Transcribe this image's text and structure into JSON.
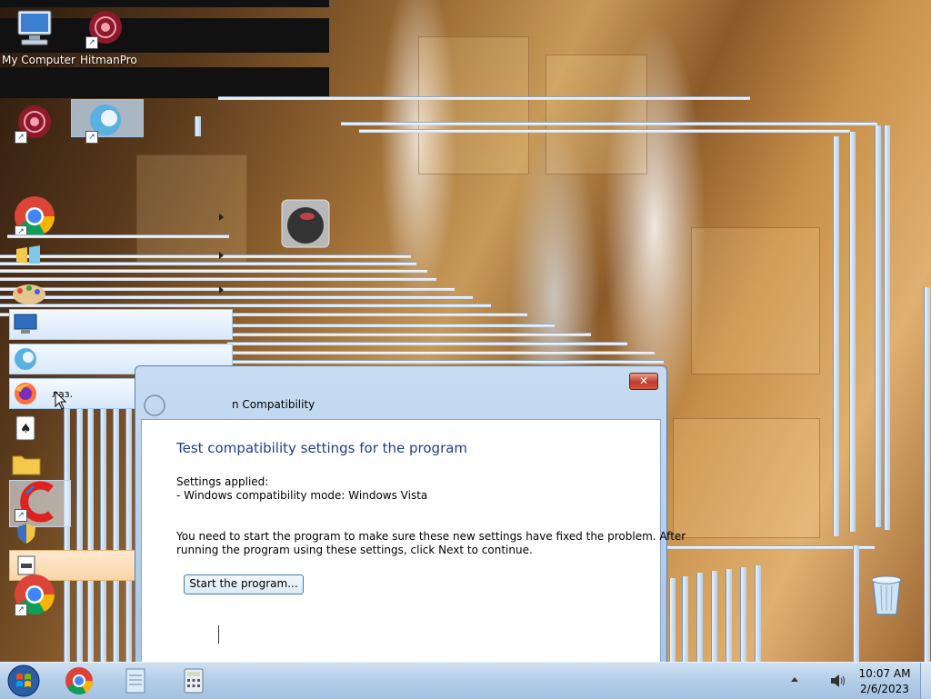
{
  "desktop": {
    "icons": [
      {
        "id": "my-computer",
        "label": "My Computer"
      },
      {
        "id": "hitmanpro",
        "label": "HitmanPro"
      }
    ]
  },
  "start_menu": {
    "hover_item_label": "лаз."
  },
  "dialog": {
    "title": "Program Compatibility",
    "title_visible": "n Compatibility",
    "close_label": "✕",
    "heading": "Test compatibility settings for the program",
    "settings_label": "Settings applied:",
    "settings_item": "- Windows compatibility mode: Windows Vista",
    "instructions_line1": "You need to start the program to make sure these new settings have fixed the problem. After",
    "instructions_line2": "running the program using these settings, click Next to continue.",
    "start_button": "Start the program..."
  },
  "taskbar": {
    "time": "10:07 AM",
    "date": "2/6/2023",
    "pinned": [
      "start-orb-icon",
      "chrome-icon",
      "notepad-icon",
      "calculator-icon"
    ],
    "tray": [
      "show-hidden-icons-icon",
      "volume-icon"
    ]
  },
  "colors": {
    "dialog_heading": "#1e3f8a",
    "taskbar": "#b3cde8",
    "hover": "#f9d5a8"
  }
}
